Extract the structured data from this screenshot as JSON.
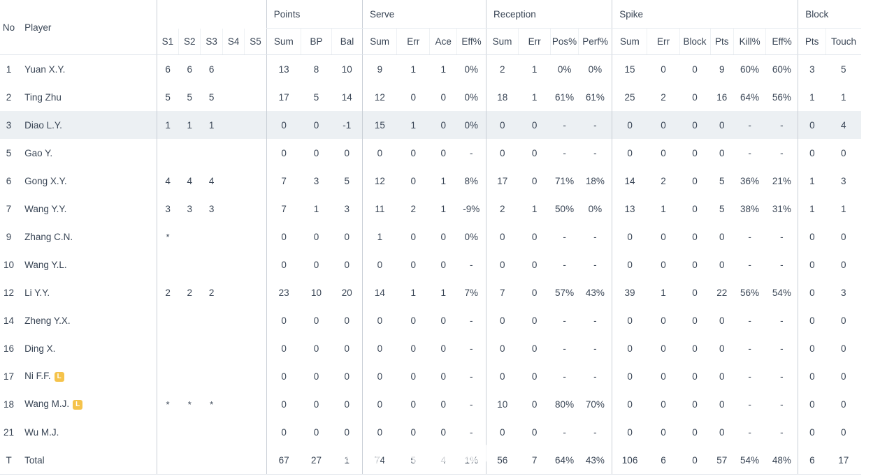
{
  "table": {
    "groups": [
      {
        "label": "",
        "span": 2
      },
      {
        "label": "",
        "span": 5
      },
      {
        "label": "Points",
        "span": 3
      },
      {
        "label": "Serve",
        "span": 4
      },
      {
        "label": "Reception",
        "span": 4
      },
      {
        "label": "Spike",
        "span": 6
      },
      {
        "label": "Block",
        "span": 2
      }
    ],
    "columns": [
      "No",
      "Player",
      "S1",
      "S2",
      "S3",
      "S4",
      "S5",
      "Sum",
      "BP",
      "Bal",
      "Sum",
      "Err",
      "Ace",
      "Eff%",
      "Sum",
      "Err",
      "Pos%",
      "Perf%",
      "Sum",
      "Err",
      "Block",
      "Pts",
      "Kill%",
      "Eff%",
      "Pts",
      "Touch"
    ],
    "rows": [
      {
        "no": "1",
        "player": "Yuan X.Y.",
        "libero": false,
        "highlight": false,
        "cells": [
          "6",
          "6",
          "6",
          "",
          "",
          "13",
          "8",
          "10",
          "9",
          "1",
          "1",
          "0%",
          "2",
          "1",
          "0%",
          "0%",
          "15",
          "0",
          "0",
          "9",
          "60%",
          "60%",
          "3",
          "5"
        ]
      },
      {
        "no": "2",
        "player": "Ting Zhu",
        "libero": false,
        "highlight": false,
        "cells": [
          "5",
          "5",
          "5",
          "",
          "",
          "17",
          "5",
          "14",
          "12",
          "0",
          "0",
          "0%",
          "18",
          "1",
          "61%",
          "61%",
          "25",
          "2",
          "0",
          "16",
          "64%",
          "56%",
          "1",
          "1"
        ]
      },
      {
        "no": "3",
        "player": "Diao L.Y.",
        "libero": false,
        "highlight": true,
        "cells": [
          "1",
          "1",
          "1",
          "",
          "",
          "0",
          "0",
          "-1",
          "15",
          "1",
          "0",
          "0%",
          "0",
          "0",
          "-",
          "-",
          "0",
          "0",
          "0",
          "0",
          "-",
          "-",
          "0",
          "4"
        ]
      },
      {
        "no": "5",
        "player": "Gao Y.",
        "libero": false,
        "highlight": false,
        "cells": [
          "",
          "",
          "",
          "",
          "",
          "0",
          "0",
          "0",
          "0",
          "0",
          "0",
          "-",
          "0",
          "0",
          "-",
          "-",
          "0",
          "0",
          "0",
          "0",
          "-",
          "-",
          "0",
          "0"
        ]
      },
      {
        "no": "6",
        "player": "Gong X.Y.",
        "libero": false,
        "highlight": false,
        "cells": [
          "4",
          "4",
          "4",
          "",
          "",
          "7",
          "3",
          "5",
          "12",
          "0",
          "1",
          "8%",
          "17",
          "0",
          "71%",
          "18%",
          "14",
          "2",
          "0",
          "5",
          "36%",
          "21%",
          "1",
          "3"
        ]
      },
      {
        "no": "7",
        "player": "Wang Y.Y.",
        "libero": false,
        "highlight": false,
        "cells": [
          "3",
          "3",
          "3",
          "",
          "",
          "7",
          "1",
          "3",
          "11",
          "2",
          "1",
          "-9%",
          "2",
          "1",
          "50%",
          "0%",
          "13",
          "1",
          "0",
          "5",
          "38%",
          "31%",
          "1",
          "1"
        ]
      },
      {
        "no": "9",
        "player": "Zhang C.N.",
        "libero": false,
        "highlight": false,
        "cells": [
          "*",
          "",
          "",
          "",
          "",
          "0",
          "0",
          "0",
          "1",
          "0",
          "0",
          "0%",
          "0",
          "0",
          "-",
          "-",
          "0",
          "0",
          "0",
          "0",
          "-",
          "-",
          "0",
          "0"
        ]
      },
      {
        "no": "10",
        "player": "Wang Y.L.",
        "libero": false,
        "highlight": false,
        "cells": [
          "",
          "",
          "",
          "",
          "",
          "0",
          "0",
          "0",
          "0",
          "0",
          "0",
          "-",
          "0",
          "0",
          "-",
          "-",
          "0",
          "0",
          "0",
          "0",
          "-",
          "-",
          "0",
          "0"
        ]
      },
      {
        "no": "12",
        "player": "Li Y.Y.",
        "libero": false,
        "highlight": false,
        "cells": [
          "2",
          "2",
          "2",
          "",
          "",
          "23",
          "10",
          "20",
          "14",
          "1",
          "1",
          "7%",
          "7",
          "0",
          "57%",
          "43%",
          "39",
          "1",
          "0",
          "22",
          "56%",
          "54%",
          "0",
          "3"
        ]
      },
      {
        "no": "14",
        "player": "Zheng Y.X.",
        "libero": false,
        "highlight": false,
        "cells": [
          "",
          "",
          "",
          "",
          "",
          "0",
          "0",
          "0",
          "0",
          "0",
          "0",
          "-",
          "0",
          "0",
          "-",
          "-",
          "0",
          "0",
          "0",
          "0",
          "-",
          "-",
          "0",
          "0"
        ]
      },
      {
        "no": "16",
        "player": "Ding X.",
        "libero": false,
        "highlight": false,
        "cells": [
          "",
          "",
          "",
          "",
          "",
          "0",
          "0",
          "0",
          "0",
          "0",
          "0",
          "-",
          "0",
          "0",
          "-",
          "-",
          "0",
          "0",
          "0",
          "0",
          "-",
          "-",
          "0",
          "0"
        ]
      },
      {
        "no": "17",
        "player": "Ni F.F.",
        "libero": true,
        "highlight": false,
        "cells": [
          "",
          "",
          "",
          "",
          "",
          "0",
          "0",
          "0",
          "0",
          "0",
          "0",
          "-",
          "0",
          "0",
          "-",
          "-",
          "0",
          "0",
          "0",
          "0",
          "-",
          "-",
          "0",
          "0"
        ]
      },
      {
        "no": "18",
        "player": "Wang M.J.",
        "libero": true,
        "highlight": false,
        "cells": [
          "*",
          "*",
          "*",
          "",
          "",
          "0",
          "0",
          "0",
          "0",
          "0",
          "0",
          "-",
          "10",
          "0",
          "80%",
          "70%",
          "0",
          "0",
          "0",
          "0",
          "-",
          "-",
          "0",
          "0"
        ]
      },
      {
        "no": "21",
        "player": "Wu M.J.",
        "libero": false,
        "highlight": false,
        "cells": [
          "",
          "",
          "",
          "",
          "",
          "0",
          "0",
          "0",
          "0",
          "0",
          "0",
          "-",
          "0",
          "0",
          "-",
          "-",
          "0",
          "0",
          "0",
          "0",
          "-",
          "-",
          "0",
          "0"
        ]
      },
      {
        "no": "T",
        "player": "Total",
        "libero": false,
        "highlight": false,
        "total": true,
        "cells": [
          "",
          "",
          "",
          "",
          "",
          "67",
          "27",
          "1",
          "74",
          "5",
          "4",
          "1%",
          "56",
          "7",
          "64%",
          "43%",
          "106",
          "6",
          "0",
          "57",
          "54%",
          "48%",
          "6",
          "17"
        ]
      }
    ],
    "libero_badge": "L"
  },
  "watermark": {
    "text": "@女排李盈莹吧",
    "logo_icon": "weibo-logo-icon"
  },
  "colors": {
    "text": "#3a4656",
    "grid": "#eef1f4",
    "group_divider": "#c9cfd6",
    "row_highlight": "#ecf0f3",
    "libero_badge": "#f5c34b"
  }
}
